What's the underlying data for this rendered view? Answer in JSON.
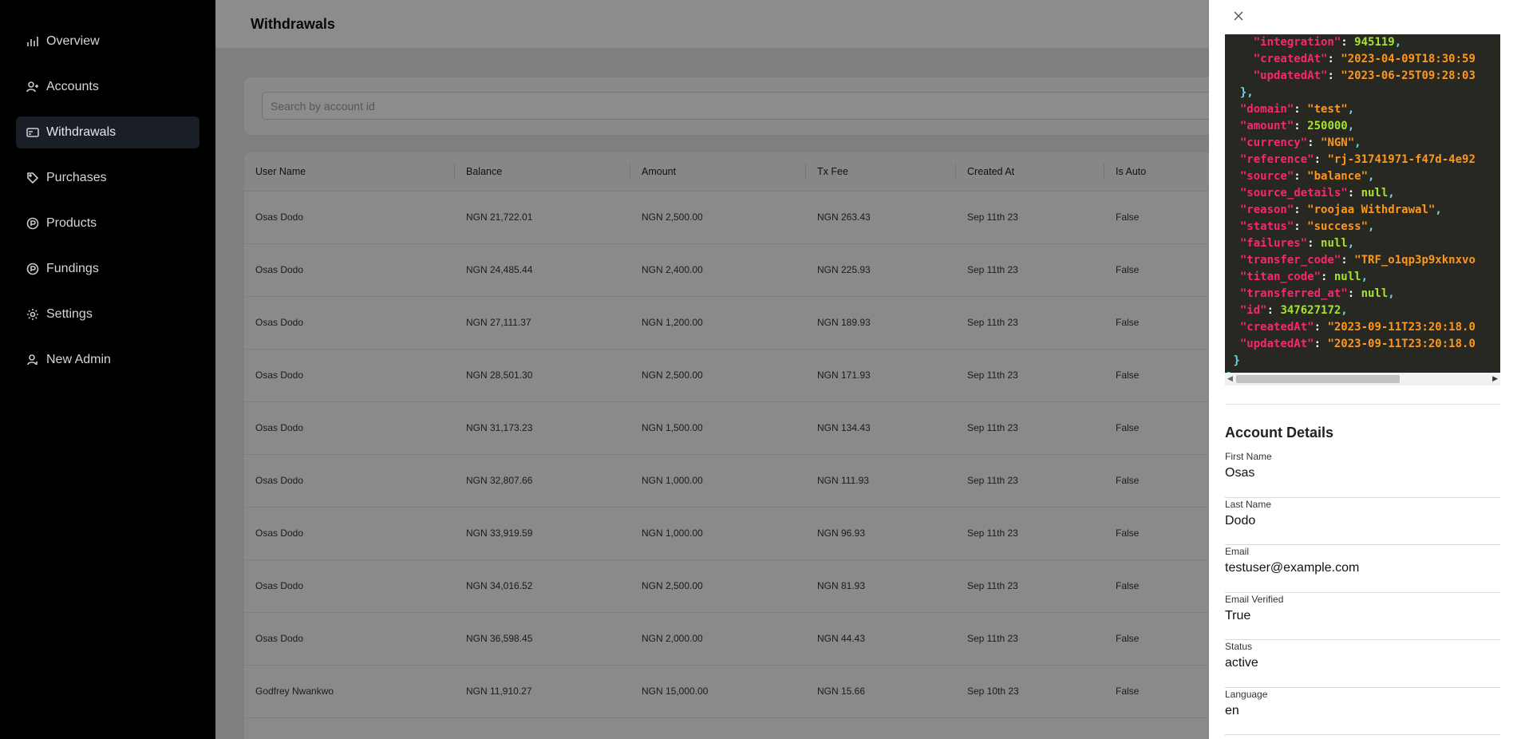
{
  "sidebar": {
    "items": [
      {
        "label": "Overview",
        "icon": "bar-chart-icon",
        "active": false
      },
      {
        "label": "Accounts",
        "icon": "users-icon",
        "active": false
      },
      {
        "label": "Withdrawals",
        "icon": "card-icon",
        "active": true
      },
      {
        "label": "Purchases",
        "icon": "tag-icon",
        "active": false
      },
      {
        "label": "Products",
        "icon": "product-circle-icon",
        "active": false
      },
      {
        "label": "Fundings",
        "icon": "funding-circle-icon",
        "active": false
      },
      {
        "label": "Settings",
        "icon": "gear-icon",
        "active": false
      },
      {
        "label": "New Admin",
        "icon": "user-add-icon",
        "active": false
      }
    ]
  },
  "header": {
    "title": "Withdrawals"
  },
  "search": {
    "placeholder": "Search by account id",
    "value": ""
  },
  "table": {
    "columns": [
      "User Name",
      "Balance",
      "Amount",
      "Tx Fee",
      "Created At",
      "Is Auto"
    ],
    "rows": [
      {
        "user": "Osas  Dodo",
        "balance": "NGN 21,722.01",
        "amount": "NGN 2,500.00",
        "fee": "NGN 263.43",
        "created": "Sep 11th 23",
        "auto": "False"
      },
      {
        "user": "Osas  Dodo",
        "balance": "NGN 24,485.44",
        "amount": "NGN 2,400.00",
        "fee": "NGN 225.93",
        "created": "Sep 11th 23",
        "auto": "False"
      },
      {
        "user": "Osas  Dodo",
        "balance": "NGN 27,111.37",
        "amount": "NGN 1,200.00",
        "fee": "NGN 189.93",
        "created": "Sep 11th 23",
        "auto": "False"
      },
      {
        "user": "Osas  Dodo",
        "balance": "NGN 28,501.30",
        "amount": "NGN 2,500.00",
        "fee": "NGN 171.93",
        "created": "Sep 11th 23",
        "auto": "False"
      },
      {
        "user": "Osas  Dodo",
        "balance": "NGN 31,173.23",
        "amount": "NGN 1,500.00",
        "fee": "NGN 134.43",
        "created": "Sep 11th 23",
        "auto": "False"
      },
      {
        "user": "Osas  Dodo",
        "balance": "NGN 32,807.66",
        "amount": "NGN 1,000.00",
        "fee": "NGN 111.93",
        "created": "Sep 11th 23",
        "auto": "False"
      },
      {
        "user": "Osas  Dodo",
        "balance": "NGN 33,919.59",
        "amount": "NGN 1,000.00",
        "fee": "NGN 96.93",
        "created": "Sep 11th 23",
        "auto": "False"
      },
      {
        "user": "Osas  Dodo",
        "balance": "NGN 34,016.52",
        "amount": "NGN 2,500.00",
        "fee": "NGN 81.93",
        "created": "Sep 11th 23",
        "auto": "False"
      },
      {
        "user": "Osas  Dodo",
        "balance": "NGN 36,598.45",
        "amount": "NGN 2,000.00",
        "fee": "NGN 44.43",
        "created": "Sep 11th 23",
        "auto": "False"
      },
      {
        "user": "Godfrey  Nwankwo",
        "balance": "NGN 11,910.27",
        "amount": "NGN 15,000.00",
        "fee": "NGN 15.66",
        "created": "Sep 10th 23",
        "auto": "False"
      }
    ]
  },
  "drawer": {
    "json_lines": [
      [
        [
          "    ",
          ""
        ],
        [
          "\"integration\"",
          "k"
        ],
        [
          ": ",
          ""
        ],
        [
          "945119",
          "n"
        ],
        [
          ",",
          "p"
        ]
      ],
      [
        [
          "    ",
          ""
        ],
        [
          "\"createdAt\"",
          "k"
        ],
        [
          ": ",
          ""
        ],
        [
          "\"2023-04-09T18:30:59",
          "s"
        ]
      ],
      [
        [
          "    ",
          ""
        ],
        [
          "\"updatedAt\"",
          "k"
        ],
        [
          ": ",
          ""
        ],
        [
          "\"2023-06-25T09:28:03",
          "s"
        ]
      ],
      [
        [
          "  ",
          ""
        ],
        [
          "},",
          "p"
        ]
      ],
      [
        [
          "  ",
          ""
        ],
        [
          "\"domain\"",
          "k"
        ],
        [
          ": ",
          ""
        ],
        [
          "\"test\"",
          "s"
        ],
        [
          ",",
          "p"
        ]
      ],
      [
        [
          "  ",
          ""
        ],
        [
          "\"amount\"",
          "k"
        ],
        [
          ": ",
          ""
        ],
        [
          "250000",
          "n"
        ],
        [
          ",",
          "p"
        ]
      ],
      [
        [
          "  ",
          ""
        ],
        [
          "\"currency\"",
          "k"
        ],
        [
          ": ",
          ""
        ],
        [
          "\"NGN\"",
          "s"
        ],
        [
          ",",
          "p"
        ]
      ],
      [
        [
          "  ",
          ""
        ],
        [
          "\"reference\"",
          "k"
        ],
        [
          ": ",
          ""
        ],
        [
          "\"rj-31741971-f47d-4e92",
          "s"
        ]
      ],
      [
        [
          "  ",
          ""
        ],
        [
          "\"source\"",
          "k"
        ],
        [
          ": ",
          ""
        ],
        [
          "\"balance\"",
          "s"
        ],
        [
          ",",
          "p"
        ]
      ],
      [
        [
          "  ",
          ""
        ],
        [
          "\"source_details\"",
          "k"
        ],
        [
          ": ",
          ""
        ],
        [
          "null",
          "n"
        ],
        [
          ",",
          "p"
        ]
      ],
      [
        [
          "  ",
          ""
        ],
        [
          "\"reason\"",
          "k"
        ],
        [
          ": ",
          ""
        ],
        [
          "\"roojaa Withdrawal\"",
          "s"
        ],
        [
          ",",
          "p"
        ]
      ],
      [
        [
          "  ",
          ""
        ],
        [
          "\"status\"",
          "k"
        ],
        [
          ": ",
          ""
        ],
        [
          "\"success\"",
          "s"
        ],
        [
          ",",
          "p"
        ]
      ],
      [
        [
          "  ",
          ""
        ],
        [
          "\"failures\"",
          "k"
        ],
        [
          ": ",
          ""
        ],
        [
          "null",
          "n"
        ],
        [
          ",",
          "p"
        ]
      ],
      [
        [
          "  ",
          ""
        ],
        [
          "\"transfer_code\"",
          "k"
        ],
        [
          ": ",
          ""
        ],
        [
          "\"TRF_o1qp3p9xknxvo",
          "s"
        ]
      ],
      [
        [
          "  ",
          ""
        ],
        [
          "\"titan_code\"",
          "k"
        ],
        [
          ": ",
          ""
        ],
        [
          "null",
          "n"
        ],
        [
          ",",
          "p"
        ]
      ],
      [
        [
          "  ",
          ""
        ],
        [
          "\"transferred_at\"",
          "k"
        ],
        [
          ": ",
          ""
        ],
        [
          "null",
          "n"
        ],
        [
          ",",
          "p"
        ]
      ],
      [
        [
          "  ",
          ""
        ],
        [
          "\"id\"",
          "k"
        ],
        [
          ": ",
          ""
        ],
        [
          "347627172",
          "n"
        ],
        [
          ",",
          "p"
        ]
      ],
      [
        [
          "  ",
          ""
        ],
        [
          "\"createdAt\"",
          "k"
        ],
        [
          ": ",
          ""
        ],
        [
          "\"2023-09-11T23:20:18.0",
          "s"
        ]
      ],
      [
        [
          "  ",
          ""
        ],
        [
          "\"updatedAt\"",
          "k"
        ],
        [
          ": ",
          ""
        ],
        [
          "\"2023-09-11T23:20:18.0",
          "s"
        ]
      ],
      [
        [
          " ",
          ""
        ],
        [
          "}",
          "p"
        ]
      ],
      [
        [
          "}",
          "p"
        ]
      ]
    ],
    "account_title": "Account Details",
    "fields": [
      {
        "label": "First Name",
        "value": "Osas"
      },
      {
        "label": "Last Name",
        "value": "Dodo"
      },
      {
        "label": "Email",
        "value": "testuser@example.com"
      },
      {
        "label": "Email Verified",
        "value": "True"
      },
      {
        "label": "Status",
        "value": "active"
      },
      {
        "label": "Language",
        "value": "en"
      }
    ]
  }
}
